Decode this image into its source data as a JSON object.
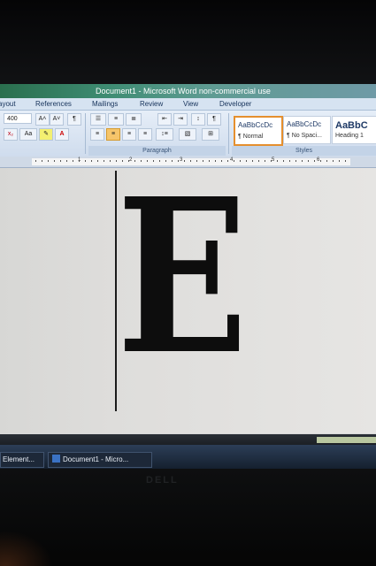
{
  "window": {
    "title": "Document1 - Microsoft Word non-commercial use"
  },
  "ribbon_tabs": [
    "ayout",
    "References",
    "Mailings",
    "Review",
    "View",
    "Developer"
  ],
  "ribbon": {
    "font_size": "400",
    "grow_font": "A˄",
    "shrink_font": "A˅",
    "clear_format": "¶",
    "case_button": "Aa",
    "paragraph_label": "Paragraph",
    "styles_label": "Styles",
    "sort_button": "↕",
    "show_marks": "¶"
  },
  "styles": [
    {
      "sample": "AaBbCcDc",
      "name": "¶ Normal",
      "selected": true
    },
    {
      "sample": "AaBbCcDc",
      "name": "¶ No Spaci...",
      "selected": false
    },
    {
      "sample": "AaBbC",
      "name": "Heading 1",
      "selected": false
    }
  ],
  "ruler": {
    "numbers": [
      "1",
      "2",
      "3",
      "4",
      "5",
      "6"
    ]
  },
  "document": {
    "content": "E"
  },
  "taskbar": {
    "items": [
      {
        "label": "Element..."
      },
      {
        "label": "Document1 - Micro..."
      }
    ]
  },
  "monitor_brand": "DELL",
  "colors": {
    "accent": "#e58f2e",
    "ribbon": "#d6e3f1",
    "taskbar": "#1d2838"
  }
}
